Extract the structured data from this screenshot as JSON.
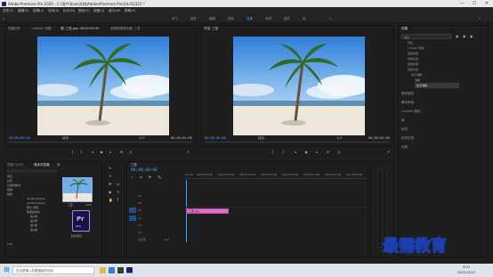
{
  "window": {
    "title": "Adobe Premiere Pro 2020 - C:\\用户\\Xiao\\文档\\Adobe\\Premiere Pro\\14.0\\2222 *",
    "min": "—",
    "max": "☐",
    "close": "✕"
  },
  "menu": [
    "文件(F)",
    "编辑(E)",
    "剪辑(C)",
    "序列(S)",
    "标记(M)",
    "图形(G)",
    "视图(V)",
    "窗口(W)",
    "帮助(H)"
  ],
  "workspaces": [
    "学习",
    "组件",
    "编辑",
    "颜色",
    "效果",
    "音频",
    "图形",
    "库"
  ],
  "active_workspace": "效果",
  "source_monitor": {
    "tabs": [
      "效果控件",
      "Lumetri 范围",
      "源: 三亚.jpg: 00:00:00:00",
      "音频剪辑混合器: 三亚"
    ],
    "timecode_left": "00;00;00;00",
    "fit": "适合",
    "page": "1/2",
    "timecode_right": "00;00;05;00"
  },
  "program_monitor": {
    "title": "节目: 三亚",
    "timecode_left": "00;00;00;00",
    "fit": "适合",
    "page": "1/2",
    "timecode_right": "00;00;05;00"
  },
  "project": {
    "tabs": [
      "项目: 2222",
      "媒体浏览器",
      "库"
    ],
    "items": [
      "项目",
      "位置",
      "以前的版本",
      "回收",
      "我的",
      "Adobe Premie",
      "Adobe Premie",
      "照片 视频",
      "我要提供的",
      "第1类",
      "第2类",
      "第3类",
      "第4类",
      "Y:\\8"
    ],
    "thumb_label": "三亚",
    "thumb_meta": "5:00",
    "file_label": "新建项目"
  },
  "timeline": {
    "tab": "三亚",
    "timecode": "00;00;00;00",
    "ruler": [
      "00;00",
      "00;00;05;00",
      "00;00;10;00",
      "00;00;15;00",
      "00;00;20;00",
      "00;00;25;00",
      "00;00;30;00",
      "00;00;35;00",
      "00;00;40;00",
      "00;00;45;00",
      "00;00;50;00",
      "00;00;55;00"
    ],
    "tracks": [
      "V3",
      "V2",
      "V1",
      "A1",
      "A2",
      "A3"
    ],
    "master": "主声道",
    "master_val": "0.0",
    "clip": "三亚.jpg"
  },
  "effects": {
    "title": "效果",
    "search_label": "预设",
    "tree": [
      "预设",
      "Lumetri 预设",
      "音频效果",
      "音频过渡",
      "视频效果",
      "视频过渡",
      "交叉溶解",
      "溶解",
      "交叉溶解"
    ],
    "sections": [
      "基本图形",
      "基本声音",
      "Lumetri 颜色",
      "库",
      "标记",
      "历史记录",
      "信息"
    ]
  },
  "taskbar": {
    "search": "在这里输入你要搜索的内容",
    "time": "9:23",
    "date": "2021/11/12"
  },
  "watermark": "最需教育",
  "colors": {
    "accent": "#3ea0ff",
    "clip": "#e070c8"
  }
}
